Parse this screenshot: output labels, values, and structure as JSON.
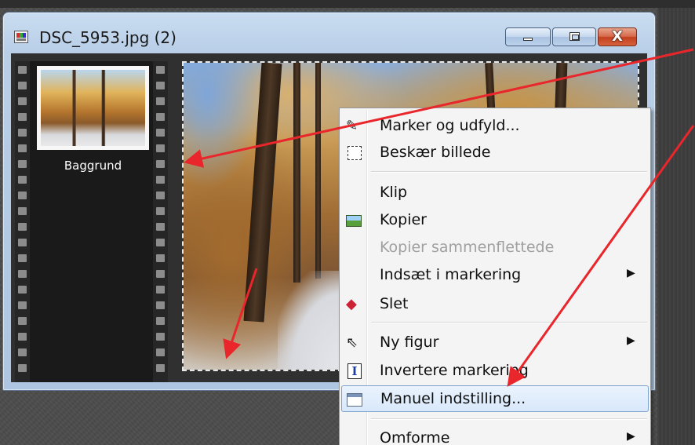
{
  "window": {
    "title": "DSC_5953.jpg (2)",
    "close_glyph": "X"
  },
  "filmstrip": {
    "layer_label": "Baggrund"
  },
  "context_menu": {
    "items": [
      {
        "label": "Marker og udfyld...",
        "icon": "magic-select-icon",
        "enabled": true
      },
      {
        "label": "Beskær billede",
        "icon": "crop-selection-icon",
        "enabled": true
      },
      {
        "label": "Klip",
        "icon": "",
        "enabled": true
      },
      {
        "label": "Kopier",
        "icon": "copy-image-icon",
        "enabled": true
      },
      {
        "label": "Kopier sammenflettede",
        "icon": "",
        "enabled": false
      },
      {
        "label": "Indsæt i markering",
        "icon": "",
        "enabled": true,
        "submenu": true
      },
      {
        "label": "Slet",
        "icon": "eraser-icon",
        "enabled": true
      },
      {
        "label": "Ny figur",
        "icon": "cursor-arrow-icon",
        "enabled": true,
        "submenu": true
      },
      {
        "label": "Invertere markering",
        "icon": "invert-selection-icon",
        "enabled": true
      },
      {
        "label": "Manuel indstilling...",
        "icon": "manual-settings-icon",
        "enabled": true,
        "highlighted": true
      },
      {
        "label": "Omforme",
        "icon": "",
        "enabled": true,
        "submenu": true
      }
    ],
    "submenu_glyph": "▶"
  },
  "colors": {
    "annotation_arrow": "#e8262b",
    "titlebar": "#b9cfe8",
    "menu_highlight_border": "#7da2ce"
  }
}
